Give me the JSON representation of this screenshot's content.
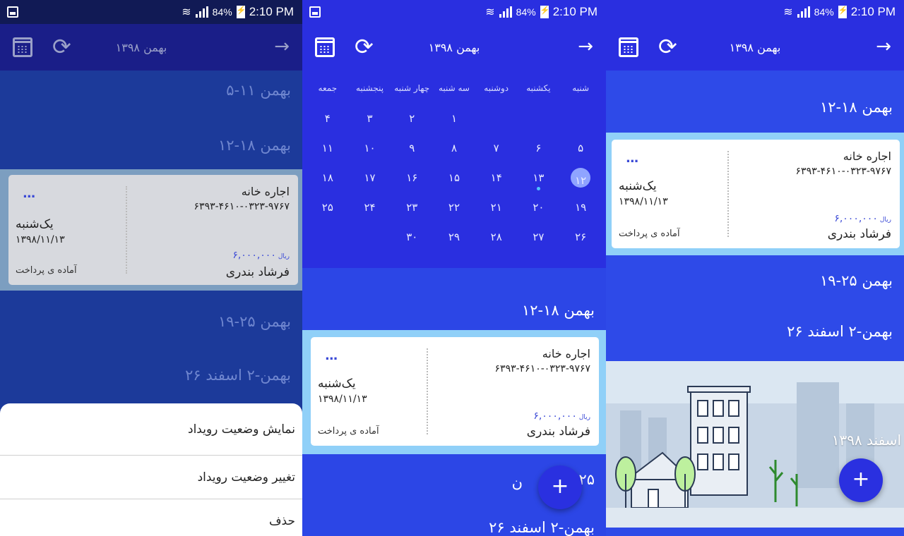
{
  "status_bar": {
    "battery": "84%",
    "time": "2:10 PM"
  },
  "app_bar": {
    "title": "بهمن ۱۳۹۸",
    "back_icon": "arrow-right-icon",
    "calendar_icon": "calendar-icon",
    "sync_icon": "sync-icon"
  },
  "weeks": {
    "w1": "۵-۱۱ بهمن",
    "w2": "۱۲-۱۸ بهمن",
    "w3": "۱۹-۲۵ بهمن",
    "w4": "۲۶ بهمن-۲ اسفند",
    "w3_partial_right": "۲۵",
    "w3_partial_left": "ن",
    "month_header": "اسفند ۱۳۹۸"
  },
  "event_card": {
    "title": "اجاره خانه",
    "account": "۶۳۹۳-۴۶۱۰-۰۳۲۳-۹۷۶۷",
    "amount": "۶,۰۰۰,۰۰۰",
    "currency": "ریال",
    "payee": "فرشاد بندری",
    "day": "یک‌شنبه",
    "date": "۱۳۹۸/۱۱/۱۳",
    "status": "آماده ی پرداخت",
    "more": "..."
  },
  "calendar": {
    "weekdays": [
      "شنبه",
      "یکشنبه",
      "دوشنبه",
      "سه شنبه",
      "چهار شنبه",
      "پنجشنبه",
      "جمعه"
    ],
    "rows": [
      [
        "",
        "",
        "",
        "۱",
        "۲",
        "۳",
        "۴"
      ],
      [
        "۵",
        "۶",
        "۷",
        "۸",
        "۹",
        "۱۰",
        "۱۱"
      ],
      [
        "۱۲",
        "۱۳",
        "۱۴",
        "۱۵",
        "۱۶",
        "۱۷",
        "۱۸"
      ],
      [
        "۱۹",
        "۲۰",
        "۲۱",
        "۲۲",
        "۲۳",
        "۲۴",
        "۲۵"
      ],
      [
        "۲۶",
        "۲۷",
        "۲۸",
        "۲۹",
        "۳۰",
        "",
        ""
      ]
    ],
    "today": "۱۲",
    "event_day": "۱۳"
  },
  "bottom_sheet": {
    "show_status": "نمایش وضعیت رویداد",
    "change_status": "تغییر وضعیت رویداد",
    "delete": "حذف"
  },
  "fab": {
    "label": "+"
  },
  "colors": {
    "primary": "#2a2fe0",
    "accent": "#3a49d6",
    "today": "#f5d100",
    "light_band": "#90d0f8"
  }
}
